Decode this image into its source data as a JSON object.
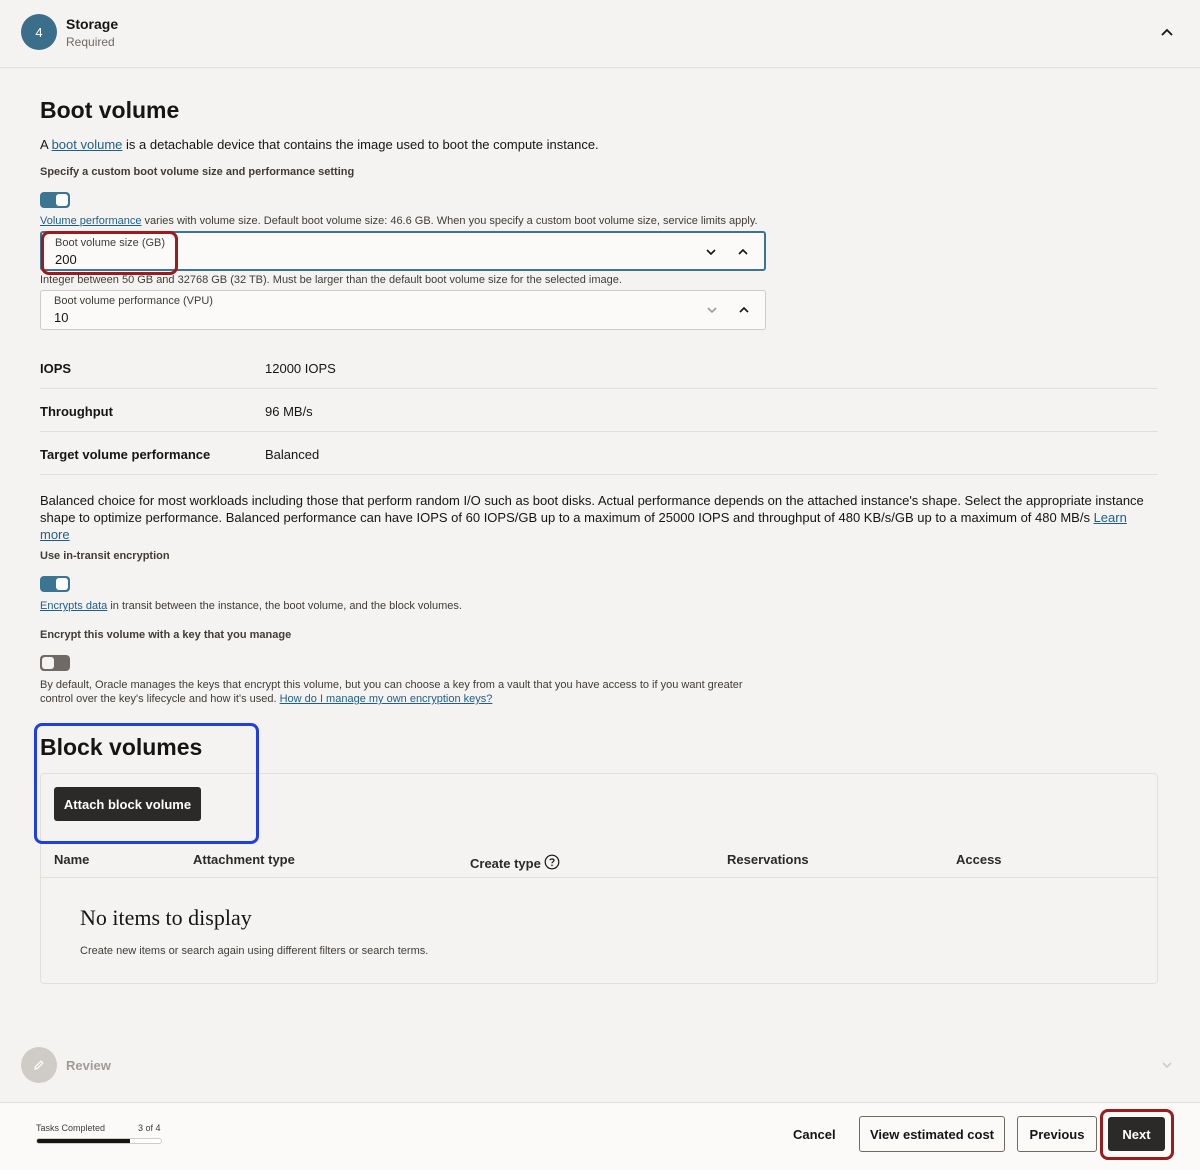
{
  "step": {
    "number": "4",
    "title": "Storage",
    "subtitle": "Required"
  },
  "boot_volume": {
    "heading": "Boot volume",
    "intro_prefix": "A ",
    "intro_link": "boot volume",
    "intro_suffix": " is a detachable device that contains the image used to boot the compute instance.",
    "custom_label": "Specify a custom boot volume size and performance setting",
    "custom_enabled": true,
    "perf_link": "Volume performance",
    "perf_note": " varies with volume size. Default boot volume size: 46.6 GB. When you specify a custom boot volume size, service limits apply.",
    "size_field": {
      "label": "Boot volume size (GB)",
      "value": "200",
      "helper": "Integer between 50 GB and 32768 GB (32 TB). Must be larger than the default boot volume size for the selected image."
    },
    "vpu_field": {
      "label": "Boot volume performance (VPU)",
      "value": "10"
    },
    "details": [
      {
        "key": "IOPS",
        "value": "12000 IOPS"
      },
      {
        "key": "Throughput",
        "value": "96 MB/s"
      },
      {
        "key": "Target volume performance",
        "value": "Balanced"
      }
    ],
    "description": "Balanced choice for most workloads including those that perform random I/O such as boot disks. Actual performance depends on the attached instance's shape. Select the appropriate instance shape to optimize performance. Balanced performance can have IOPS of 60 IOPS/GB up to a maximum of 25000 IOPS and throughput of 480 KB/s/GB up to a maximum of 480 MB/s ",
    "learn_more": "Learn more",
    "transit_label": "Use in-transit encryption",
    "transit_enabled": true,
    "transit_link": "Encrypts data",
    "transit_note": " in transit between the instance, the boot volume, and the block volumes.",
    "key_label": "Encrypt this volume with a key that you manage",
    "key_enabled": false,
    "key_note_line1": "By default, Oracle manages the keys that encrypt this volume, but you can choose a key from a vault that you have access to if you want greater",
    "key_note_line2": "control over the key's lifecycle and how it's used. ",
    "key_link": "How do I manage my own encryption keys?"
  },
  "block_volumes": {
    "heading": "Block volumes",
    "attach_button": "Attach block volume",
    "columns": [
      "Name",
      "Attachment type",
      "Create type",
      "Reservations",
      "Access"
    ],
    "empty_title": "No items to display",
    "empty_subtitle": "Create new items or search again using different filters or search terms."
  },
  "review_step": {
    "title": "Review"
  },
  "footer": {
    "tasks_label": "Tasks Completed",
    "tasks_count": "3 of 4",
    "progress_fraction": 0.75,
    "cancel": "Cancel",
    "view_cost": "View estimated cost",
    "previous": "Previous",
    "next": "Next"
  },
  "colors": {
    "accent": "#3b7591",
    "annotation_red": "#9b1c1c",
    "annotation_blue": "#1f3fe0"
  }
}
